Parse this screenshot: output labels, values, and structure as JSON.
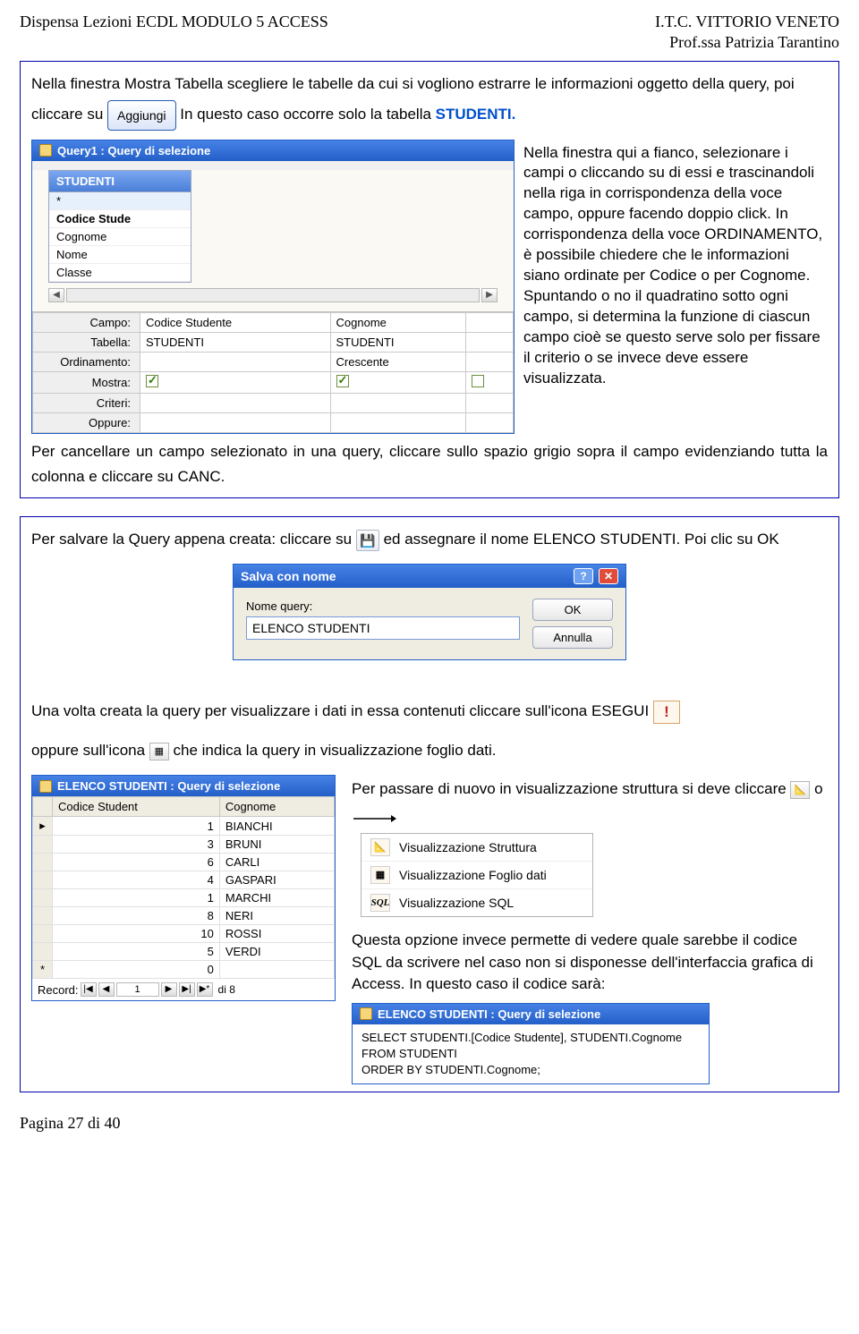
{
  "header": {
    "left": "Dispensa Lezioni ECDL  MODULO 5 ACCESS",
    "right1": "I.T.C. VITTORIO VENETO",
    "right2": "Prof.ssa Patrizia Tarantino"
  },
  "p1a": "Nella finestra Mostra Tabella scegliere le tabelle da cui si vogliono estrarre le informazioni oggetto della query, poi cliccare su ",
  "aggiungi": "Aggiungi",
  "p1b": " In questo caso occorre solo la tabella ",
  "studenti": "STUDENTI.",
  "qwin": {
    "title": "Query1 : Query di selezione",
    "table_name": "STUDENTI",
    "fields": [
      "*",
      "Codice Stude",
      "Cognome",
      "Nome",
      "Classe"
    ],
    "labels": [
      "Campo:",
      "Tabella:",
      "Ordinamento:",
      "Mostra:",
      "Criteri:",
      "Oppure:"
    ],
    "c1": {
      "campo": "Codice Studente",
      "tabella": "STUDENTI",
      "ord": ""
    },
    "c2": {
      "campo": "Cognome",
      "tabella": "STUDENTI",
      "ord": "Crescente"
    }
  },
  "side": "Nella finestra qui a fianco, selezionare i campi o cliccando su di essi e trascinandoli nella riga in corrispondenza della voce campo, oppure facendo doppio click. In corrispondenza della voce ORDINAMENTO, è possibile chiedere che le informazioni siano ordinate per Codice o per Cognome. Spuntando o no il quadratino sotto ogni campo, si determina la funzione di ciascun campo cioè se questo serve solo per fissare il criterio o se invece deve essere visualizzata.",
  "p2": "Per cancellare un campo selezionato in una query, cliccare sullo spazio grigio sopra il campo evidenziando tutta la colonna e cliccare su CANC.",
  "save_text_a": "Per salvare la Query appena creata: cliccare su ",
  "save_text_b": " ed assegnare il nome ELENCO STUDENTI. Poi clic su OK",
  "saveas": {
    "title": "Salva con nome",
    "label": "Nome query:",
    "value": "ELENCO STUDENTI",
    "ok": "OK",
    "cancel": "Annulla"
  },
  "p3a": "Una volta creata la query per visualizzare i dati in essa contenuti cliccare sull'icona ESEGUI ",
  "p3b": "oppure sull'icona ",
  "p3c": " che indica la query in visualizzazione foglio dati.",
  "ds": {
    "title": "ELENCO STUDENTI : Query di selezione",
    "cols": [
      "Codice Student",
      "Cognome"
    ],
    "rows": [
      [
        "1",
        "BIANCHI"
      ],
      [
        "3",
        "BRUNI"
      ],
      [
        "6",
        "CARLI"
      ],
      [
        "4",
        "GASPARI"
      ],
      [
        "1",
        "MARCHI"
      ],
      [
        "8",
        "NERI"
      ],
      [
        "10",
        "ROSSI"
      ],
      [
        "5",
        "VERDI"
      ]
    ],
    "newrow": "0",
    "nav_label": "Record:",
    "nav_pos": "1",
    "nav_of": "di 8"
  },
  "r1": "Per passare di nuovo in visualizzazione struttura si deve cliccare ",
  "r1b": " o",
  "menu": {
    "i1": "Visualizzazione Struttura",
    "i2": "Visualizzazione Foglio dati",
    "i3": "Visualizzazione SQL",
    "sql_label": "SQL"
  },
  "r2": "Questa opzione invece permette di vedere quale sarebbe il codice SQL da scrivere nel caso non si disponesse dell'interfaccia grafica di Access. In questo caso il codice sarà:",
  "sql": {
    "title": "ELENCO STUDENTI : Query di selezione",
    "l1": "SELECT STUDENTI.[Codice Studente], STUDENTI.Cognome",
    "l2": "FROM STUDENTI",
    "l3": "ORDER BY STUDENTI.Cognome;"
  },
  "footer": "Pagina 27 di 40"
}
